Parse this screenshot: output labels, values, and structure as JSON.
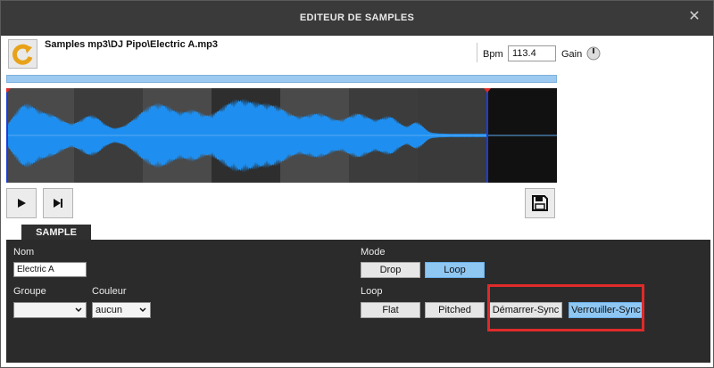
{
  "window": {
    "title": "EDITEUR DE SAMPLES",
    "close_glyph": "✕"
  },
  "toolbar": {
    "reload_icon": "reload-icon",
    "file_path": "Samples mp3\\DJ Pipo\\Electric A.mp3",
    "bpm_label": "Bpm",
    "bpm_value": "113.4",
    "gain_label": "Gain"
  },
  "playback": {
    "play_icon": "play-icon",
    "next_icon": "skip-next-icon",
    "save_icon": "save-icon"
  },
  "colors": {
    "accent": "#8fc7f3",
    "waveform": "#1e8ff0",
    "panel": "#2b2b2b",
    "highlight": "#e02a2a"
  },
  "sample": {
    "tab_label": "SAMPLE",
    "name_label": "Nom",
    "name_value": "Electric A",
    "group_label": "Groupe",
    "group_value": "",
    "color_label": "Couleur",
    "color_value": "aucun",
    "mode_label": "Mode",
    "mode_buttons": [
      {
        "label": "Drop",
        "active": false
      },
      {
        "label": "Loop",
        "active": true
      }
    ],
    "loop_label": "Loop",
    "loop_buttons": [
      {
        "label": "Flat",
        "active": false
      },
      {
        "label": "Pitched",
        "active": false
      },
      {
        "label": "Démarrer-Sync",
        "active": false
      },
      {
        "label": "Verrouiller-Sync",
        "active": true
      }
    ]
  }
}
